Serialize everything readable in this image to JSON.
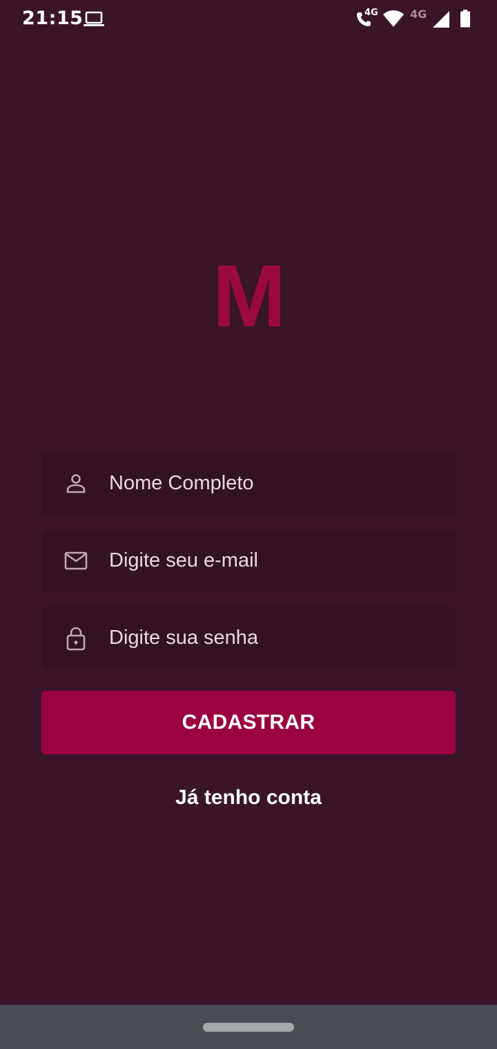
{
  "status_bar": {
    "time": "21:15",
    "call_network": "4G",
    "signal_network": "4G",
    "icons": [
      "laptop-icon",
      "wifi-call-icon",
      "wifi-icon",
      "cell-signal-icon",
      "battery-icon"
    ]
  },
  "logo": {
    "text": "M",
    "color": "#9b0a3d"
  },
  "form": {
    "name_placeholder": "Nome Completo",
    "email_placeholder": "Digite seu e-mail",
    "password_placeholder": "Digite sua senha",
    "icons": [
      "person-icon",
      "mail-icon",
      "lock-icon"
    ]
  },
  "actions": {
    "register_label": "CADASTRAR",
    "login_link": "Já tenho conta"
  },
  "colors": {
    "background": "#3a1528",
    "field_background": "#331223",
    "accent": "#9b0340",
    "text": "#ffffff",
    "nav_bar": "#474d53"
  }
}
